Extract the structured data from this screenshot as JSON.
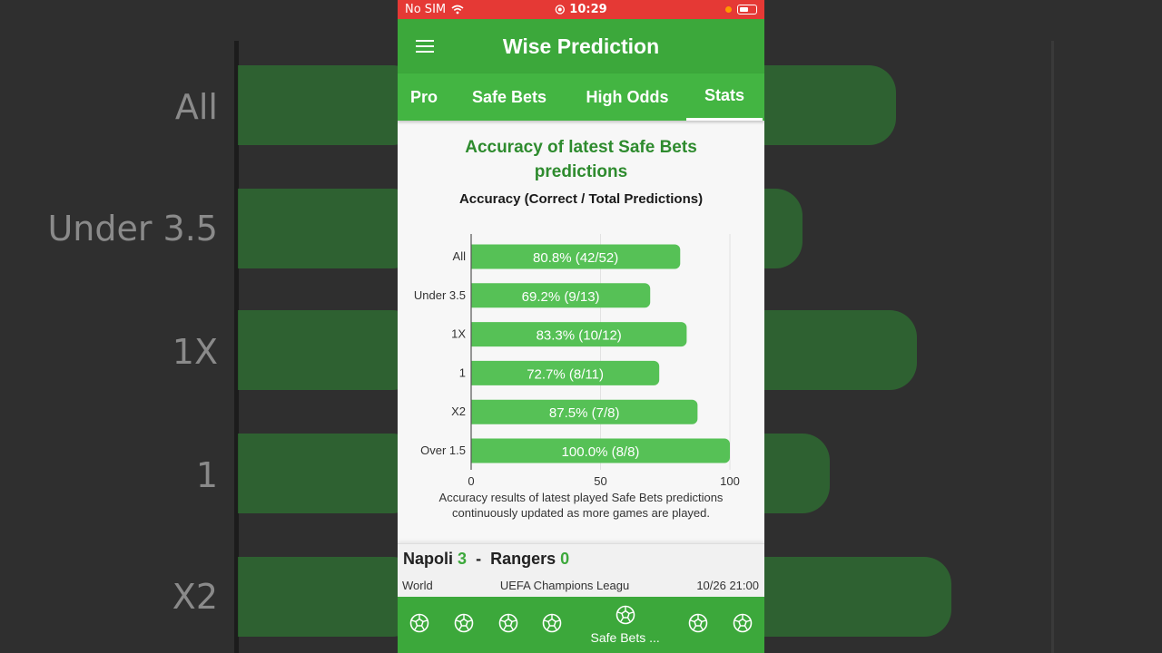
{
  "status_bar": {
    "carrier": "No SIM",
    "time": "10:29"
  },
  "app": {
    "title": "Wise Prediction"
  },
  "tabs": [
    {
      "label": "Pro",
      "active": false
    },
    {
      "label": "Safe Bets",
      "active": false
    },
    {
      "label": "High Odds",
      "active": false
    },
    {
      "label": "Stats",
      "active": true
    }
  ],
  "stats": {
    "title": "Accuracy of latest Safe Bets predictions",
    "subtitle": "Accuracy (Correct / Total Predictions)",
    "note_line1": "Accuracy results of latest played Safe Bets predictions",
    "note_line2": "continuously updated as more games are played."
  },
  "chart_data": {
    "type": "bar",
    "orientation": "horizontal",
    "title": "Accuracy (Correct / Total Predictions)",
    "categories": [
      "All",
      "Under 3.5",
      "1X",
      "1",
      "X2",
      "Over 1.5"
    ],
    "values": [
      80.8,
      69.2,
      83.3,
      72.7,
      87.5,
      100.0
    ],
    "data_labels": [
      "80.8%  (42/52)",
      "69.2%  (9/13)",
      "83.3%  (10/12)",
      "72.7%  (8/11)",
      "87.5%  (7/8)",
      "100.0%  (8/8)"
    ],
    "xlim": [
      0,
      100
    ],
    "xticks": [
      0,
      50,
      100
    ],
    "grid": true,
    "bar_color": "#56c156"
  },
  "match": {
    "home": "Napoli",
    "home_score": "3",
    "separator": "-",
    "away": "Rangers",
    "away_score": "0",
    "region": "World",
    "competition": "UEFA Champions Leagu",
    "datetime": "10/26 21:00"
  },
  "bottom_nav": {
    "active_label": "Safe Bets ...",
    "icon": "soccer-ball-icon",
    "items": 7,
    "active_index": 4
  },
  "background_blur": {
    "labels": [
      "All",
      "Under 3.5",
      "1X",
      "1",
      "X2"
    ]
  },
  "colors": {
    "status_bar": "#e53935",
    "app_bar": "#3ca83b",
    "tab_bar": "#43b542",
    "title_green": "#2e8b2e"
  }
}
